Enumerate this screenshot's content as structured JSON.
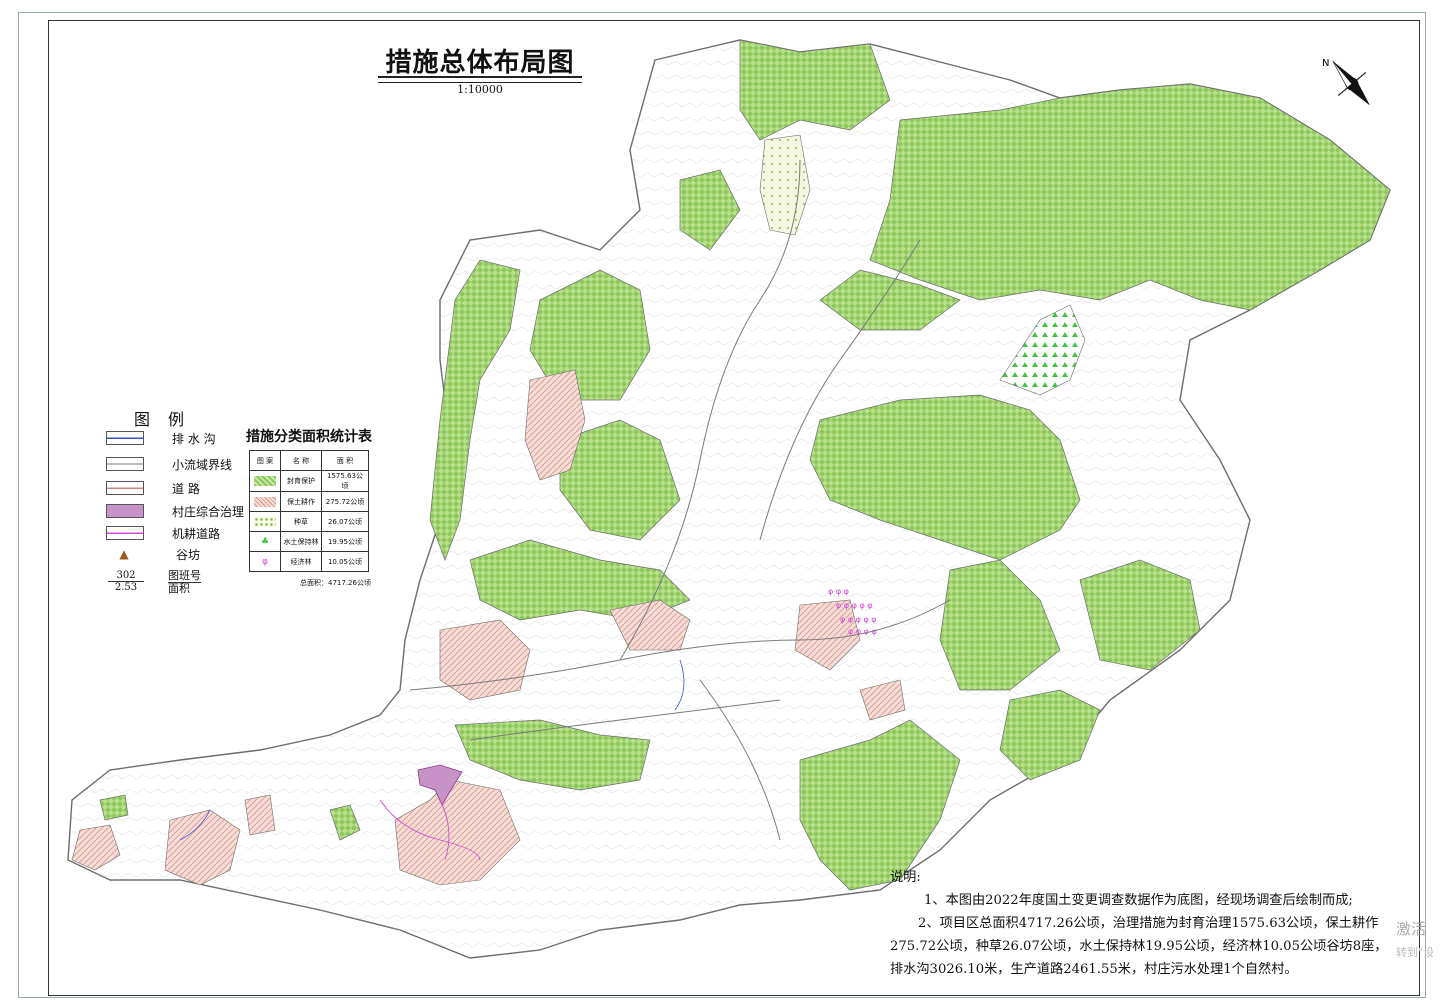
{
  "map": {
    "title": "措施总体布局图",
    "scale": "1:10000",
    "north_arrow_label": "N"
  },
  "legend": {
    "title": "图例",
    "items": [
      {
        "label": "排 水 沟",
        "icon": "drainage-ditch-line",
        "color": "#3a4fd0"
      },
      {
        "label": "小流域界线",
        "icon": "watershed-boundary-line",
        "color": "#7a7a7a"
      },
      {
        "label": "道      路",
        "icon": "road-line",
        "color": "#c98a80"
      },
      {
        "label": "村庄综合治理",
        "icon": "village-fill",
        "color": "#c792c8"
      },
      {
        "label": "机耕道路",
        "icon": "tractor-road-line",
        "color": "#d04fd6"
      },
      {
        "label": "谷坊",
        "icon": "check-dam-marker",
        "color": "#a05a1a"
      }
    ],
    "plot_number": {
      "number": "302",
      "area": "2.53",
      "label_number": "图班号",
      "label_area": "面积"
    }
  },
  "stats_table": {
    "title": "措施分类面积统计表",
    "headers": [
      "图 案",
      "名 称",
      "面 积"
    ],
    "rows": [
      {
        "name": "封育保护",
        "area": "1575.63公顷",
        "pattern": "green-check"
      },
      {
        "name": "保土耕作",
        "area": "275.72公顷",
        "pattern": "pink-hatch"
      },
      {
        "name": "种草",
        "area": "26.07公顷",
        "pattern": "grass-dots"
      },
      {
        "name": "水土保持林",
        "area": "19.95公顷",
        "pattern": "tree-green"
      },
      {
        "name": "经济林",
        "area": "10.05公顷",
        "pattern": "econ-magenta"
      }
    ],
    "total": "总面积：4717.26公顷"
  },
  "notes": {
    "heading": "说明:",
    "line1": "1、本图由2022年度国土变更调查数据作为底图，经现场调查后绘制而成;",
    "line2": "2、项目区总面积4717.26公顷，治理措施为封育治理1575.63公顷，保土耕作",
    "line3": "275.72公顷，种草26.07公顷，水土保持林19.95公顷，经济林10.05公顷谷坊8座，",
    "line4": "排水沟3026.10米，生产道路2461.55米，村庄污水处理1个自然村。"
  },
  "watermark": {
    "line1": "激活",
    "line2": "转到\"设"
  },
  "colors": {
    "forest_green": "#7cc24a",
    "crop_pink": "#f2c8c0",
    "village_purple": "#c792c8",
    "boundary_gray": "#6d6d6d"
  }
}
